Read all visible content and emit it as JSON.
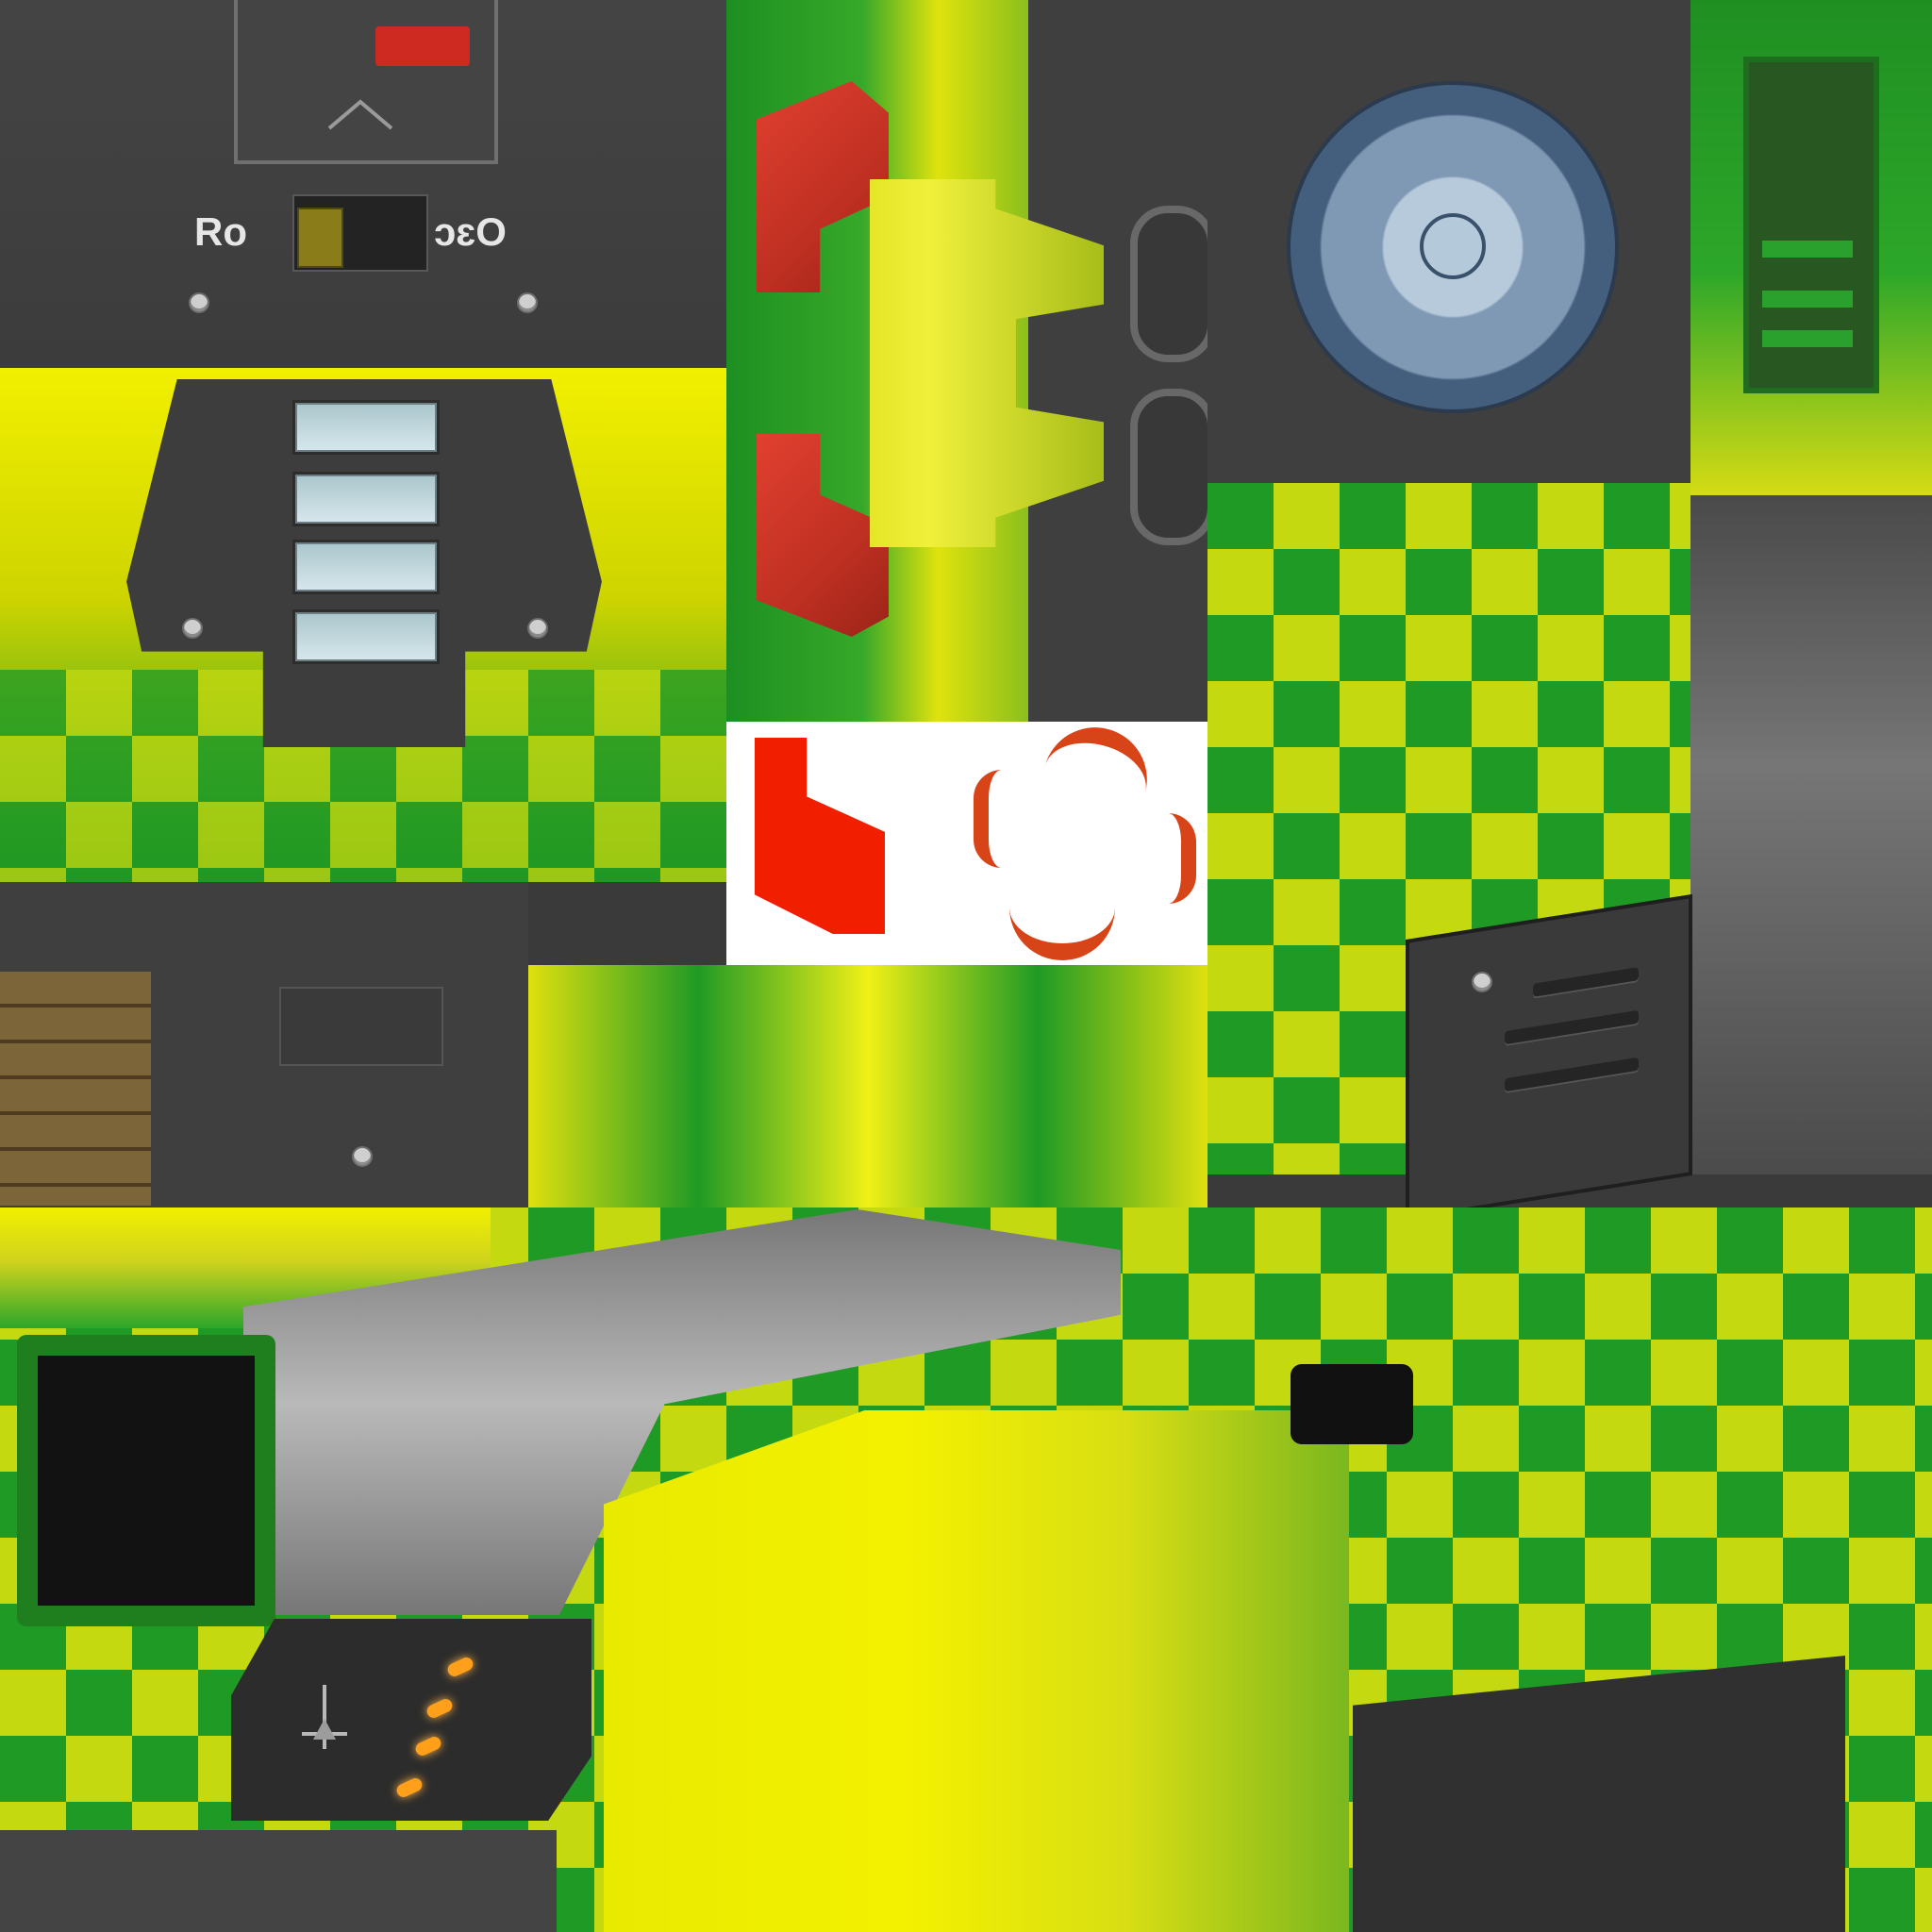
{
  "texture": {
    "plate_text_left": "Ro",
    "plate_text_right": "ɔɛO",
    "red_tag_text": "",
    "colors": {
      "green": "#1f9a25",
      "yellow": "#e3e60b",
      "gray": "#3f3f3f",
      "red": "#d83a2a",
      "blue_fan": "#7d99b8"
    }
  },
  "icons": {
    "fan": "fan-icon",
    "screw": "screw-icon",
    "vent": "vent-icon"
  }
}
